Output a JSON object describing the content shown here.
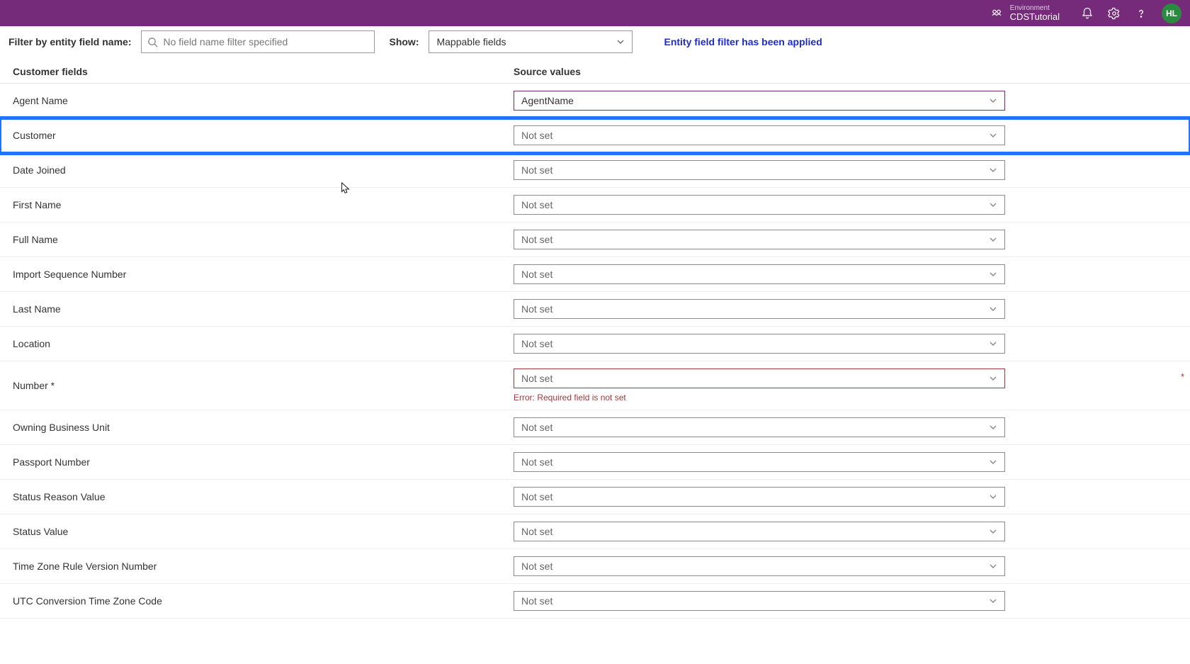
{
  "topbar": {
    "env_label": "Environment",
    "env_name": "CDSTutorial",
    "avatar": "HL"
  },
  "filterbar": {
    "filter_label": "Filter by entity field name:",
    "filter_placeholder": "No field name filter specified",
    "show_label": "Show:",
    "show_value": "Mappable fields",
    "applied_msg": "Entity field filter has been applied"
  },
  "columns": {
    "left": "Customer fields",
    "right": "Source values"
  },
  "notset": "Not set",
  "error_required": "Error: Required field is not set",
  "rows": [
    {
      "label": "Agent Name",
      "value": "AgentName",
      "accent": true
    },
    {
      "label": "Customer",
      "value": "",
      "highlight": true
    },
    {
      "label": "Date Joined",
      "value": ""
    },
    {
      "label": "First Name",
      "value": ""
    },
    {
      "label": "Full Name",
      "value": ""
    },
    {
      "label": "Import Sequence Number",
      "value": ""
    },
    {
      "label": "Last Name",
      "value": ""
    },
    {
      "label": "Location",
      "value": ""
    },
    {
      "label": "Number *",
      "value": "",
      "required": true,
      "error": true
    },
    {
      "label": "Owning Business Unit",
      "value": ""
    },
    {
      "label": "Passport Number",
      "value": ""
    },
    {
      "label": "Status Reason Value",
      "value": ""
    },
    {
      "label": "Status Value",
      "value": ""
    },
    {
      "label": "Time Zone Rule Version Number",
      "value": ""
    },
    {
      "label": "UTC Conversion Time Zone Code",
      "value": ""
    }
  ]
}
